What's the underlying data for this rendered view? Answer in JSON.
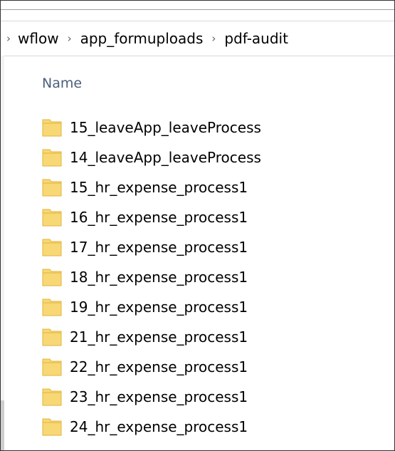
{
  "breadcrumb": {
    "segments": [
      "wflow",
      "app_formuploads",
      "pdf-audit"
    ],
    "separator": "›"
  },
  "file_list": {
    "column_header": "Name",
    "items": [
      "15_leaveApp_leaveProcess",
      "14_leaveApp_leaveProcess",
      "15_hr_expense_process1",
      "16_hr_expense_process1",
      "17_hr_expense_process1",
      "18_hr_expense_process1",
      "19_hr_expense_process1",
      "21_hr_expense_process1",
      "22_hr_expense_process1",
      "23_hr_expense_process1",
      "24_hr_expense_process1"
    ]
  },
  "colors": {
    "folder_fill": "#F8D775",
    "folder_edge": "#E0B63A",
    "header_text": "#4C607A"
  },
  "icons": {
    "folder": "folder-icon",
    "separator": "chevron-right-icon"
  }
}
